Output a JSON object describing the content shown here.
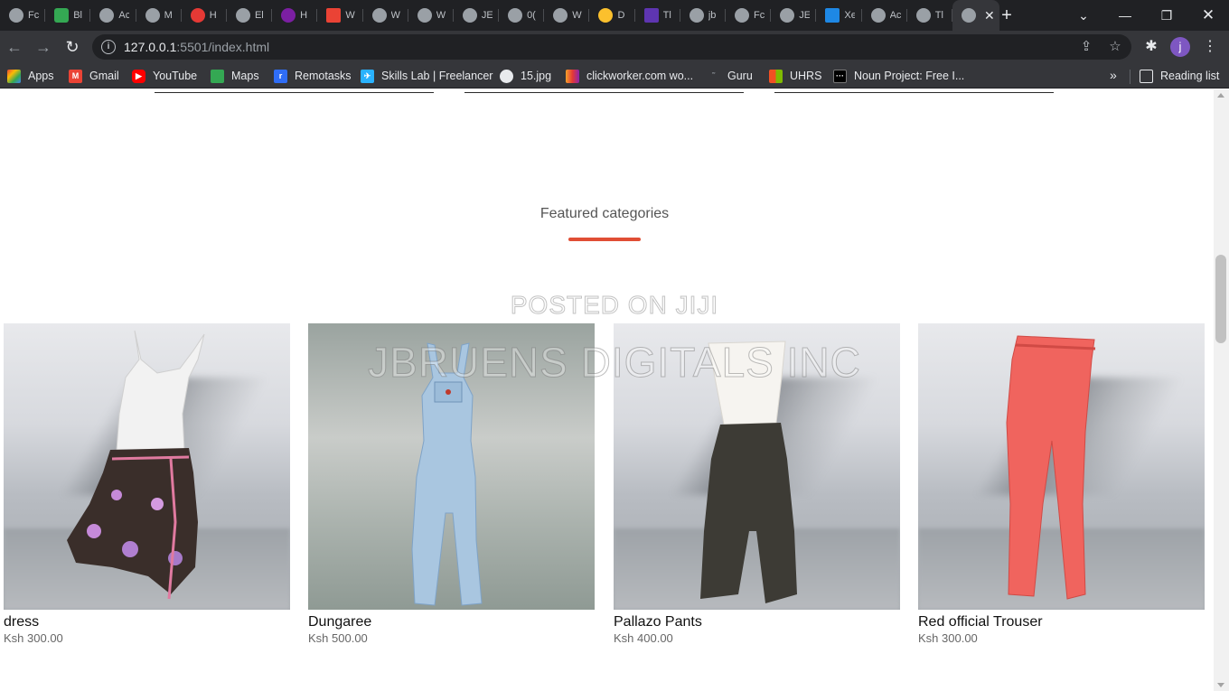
{
  "browser": {
    "tabs": [
      {
        "label": "Fc",
        "icon": "globe-icon"
      },
      {
        "label": "Bl",
        "icon": "app-icon"
      },
      {
        "label": "Ac",
        "icon": "globe-icon"
      },
      {
        "label": "M",
        "icon": "globe-icon"
      },
      {
        "label": "H",
        "icon": "app-icon"
      },
      {
        "label": "El",
        "icon": "globe-icon"
      },
      {
        "label": "H",
        "icon": "app-icon"
      },
      {
        "label": "W",
        "icon": "gmail-icon"
      },
      {
        "label": "W",
        "icon": "globe-icon"
      },
      {
        "label": "W",
        "icon": "globe-icon"
      },
      {
        "label": "JE",
        "icon": "globe-icon"
      },
      {
        "label": "0(",
        "icon": "globe-icon"
      },
      {
        "label": "W",
        "icon": "globe-icon"
      },
      {
        "label": "D",
        "icon": "app-icon"
      },
      {
        "label": "Tl",
        "icon": "app-icon"
      },
      {
        "label": "jb",
        "icon": "globe-icon"
      },
      {
        "label": "Fc",
        "icon": "globe-icon"
      },
      {
        "label": "JE",
        "icon": "globe-icon"
      },
      {
        "label": "Xe",
        "icon": "app-icon"
      },
      {
        "label": "Ac",
        "icon": "globe-icon"
      },
      {
        "label": "Tl",
        "icon": "globe-icon"
      }
    ],
    "active_tab_close": "✕",
    "new_tab": "+",
    "url_host": "127.0.0.1",
    "url_rest": ":5501/index.html",
    "avatar_letter": "j",
    "bookmarks": [
      {
        "label": "Apps",
        "icon": "apps-grid-icon",
        "color": "#ea4335"
      },
      {
        "label": "Gmail",
        "icon": "gmail-icon",
        "color": "#ea4335"
      },
      {
        "label": "YouTube",
        "icon": "youtube-icon",
        "color": "#ff0000"
      },
      {
        "label": "Maps",
        "icon": "maps-icon",
        "color": "#34a853"
      },
      {
        "label": "Remotasks",
        "icon": "remotasks-icon",
        "color": "#2f6df6"
      },
      {
        "label": "Skills Lab | Freelancer",
        "icon": "freelancer-icon",
        "color": "#29b2fe"
      },
      {
        "label": "15.jpg",
        "icon": "globe-icon",
        "color": "#e8eaed"
      },
      {
        "label": "clickworker.com wo...",
        "icon": "clickworker-icon",
        "color": "#f4a12b"
      },
      {
        "label": "Guru",
        "icon": "guru-icon",
        "color": "#5f6368"
      },
      {
        "label": "UHRS",
        "icon": "microsoft-icon",
        "color": "#f25022"
      },
      {
        "label": "Noun Project: Free I...",
        "icon": "noun-project-icon",
        "color": "#000000"
      }
    ],
    "bookmarks_more": "»",
    "reading_list": "Reading list"
  },
  "page": {
    "section_title": "Featured categories",
    "accent_color": "#e04e35",
    "watermark_line1": "POSTED ON JIJI",
    "watermark_line2": "JBRUENS DIGITALS INC",
    "products": [
      {
        "name": "dress",
        "price": "Ksh 300.00",
        "image": "dress-photo"
      },
      {
        "name": "Dungaree",
        "price": "Ksh 500.00",
        "image": "dungaree-photo"
      },
      {
        "name": "Pallazo Pants",
        "price": "Ksh 400.00",
        "image": "pallazo-pants-photo"
      },
      {
        "name": "Red official Trouser",
        "price": "Ksh 300.00",
        "image": "red-trouser-photo"
      }
    ]
  }
}
